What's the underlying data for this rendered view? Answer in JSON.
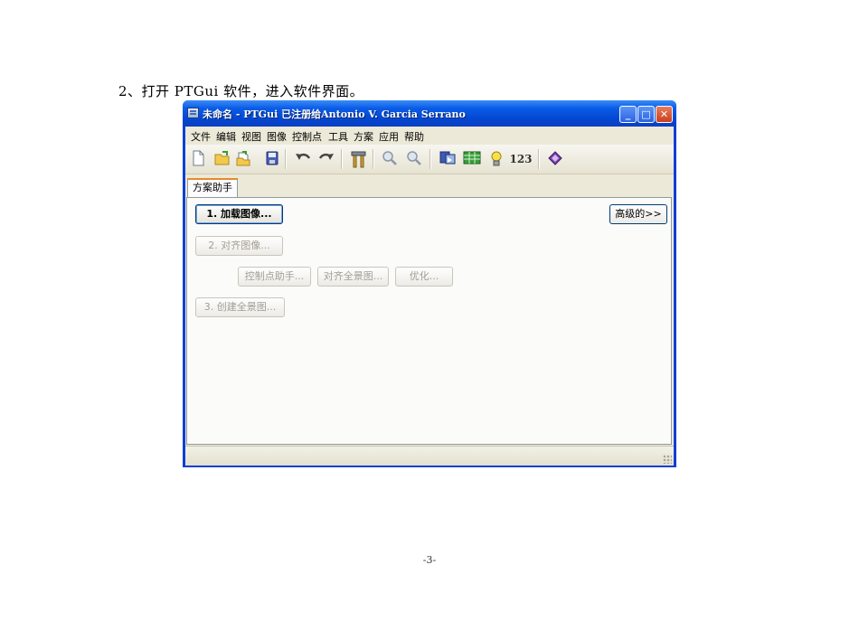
{
  "document": {
    "heading": "2、打开 PTGui 软件，进入软件界面。",
    "page_number": "-3-"
  },
  "window": {
    "title": "未命名 - PTGui 已注册给Antonio V. Garcia Serrano",
    "controls": {
      "minimize": "_",
      "maximize": "□",
      "close": "✕"
    }
  },
  "menu": [
    "文件",
    "编辑",
    "视图",
    "图像",
    "控制点",
    "工具",
    "方案",
    "应用",
    "帮助"
  ],
  "toolbar": {
    "icons": [
      "new-file-icon",
      "open-folder-icon",
      "open-recent-icon",
      "save-icon",
      "undo-icon",
      "redo-icon",
      "tools-icon",
      "zoom-in-icon",
      "zoom-out-icon",
      "preview-icon",
      "table-icon",
      "lightbulb-icon",
      "numbers-icon",
      "help-book-icon"
    ],
    "numbers_label": "123"
  },
  "tab": {
    "label": "方案助手"
  },
  "assistant": {
    "load_images": "1. 加载图像...",
    "align_images": "2. 对齐图像...",
    "control_point_assistant": "控制点助手...",
    "align_panorama": "对齐全景图...",
    "optimize": "优化...",
    "create_panorama": "3. 创建全景图...",
    "advanced": "高级的>>"
  },
  "colors": {
    "titlebar": "#0b5ce8",
    "window_bg": "#ece9d8",
    "tab_accent": "#e68b2c",
    "close_button": "#c8401f"
  }
}
